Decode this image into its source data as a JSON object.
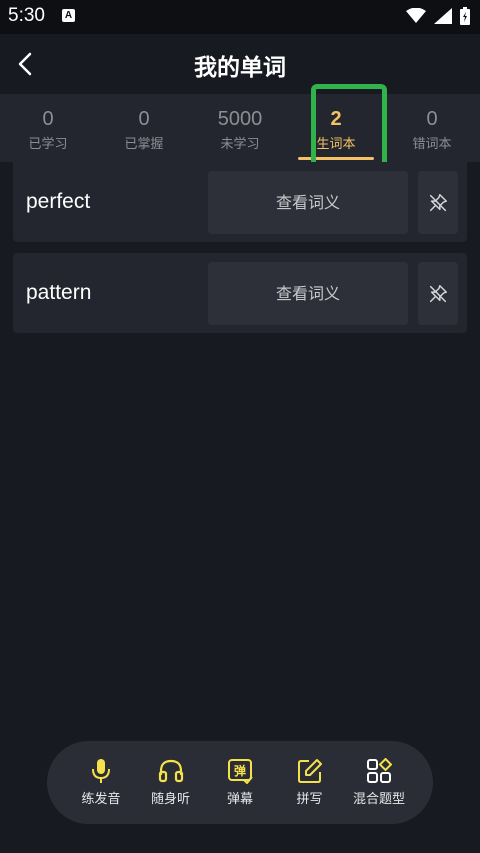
{
  "status": {
    "time": "5:30",
    "notification_badge": "A"
  },
  "header": {
    "title": "我的单词"
  },
  "tabs": [
    {
      "count": "0",
      "label": "已学习",
      "active": false
    },
    {
      "count": "0",
      "label": "已掌握",
      "active": false
    },
    {
      "count": "5000",
      "label": "未学习",
      "active": false
    },
    {
      "count": "2",
      "label": "生词本",
      "active": true
    },
    {
      "count": "0",
      "label": "错词本",
      "active": false
    }
  ],
  "words": [
    {
      "word": "perfect",
      "meaning_label": "查看词义"
    },
    {
      "word": "pattern",
      "meaning_label": "查看词义"
    }
  ],
  "toolbar": [
    {
      "label": "练发音",
      "icon": "microphone-icon"
    },
    {
      "label": "随身听",
      "icon": "headphones-icon"
    },
    {
      "label": "弹幕",
      "icon": "danmaku-icon",
      "icon_text": "弹"
    },
    {
      "label": "拼写",
      "icon": "edit-icon"
    },
    {
      "label": "混合题型",
      "icon": "apps-icon"
    }
  ],
  "colors": {
    "background": "#181a21",
    "accent": "#f4c264",
    "highlight": "#2fb34a",
    "icon_yellow": "#f5e14a"
  }
}
